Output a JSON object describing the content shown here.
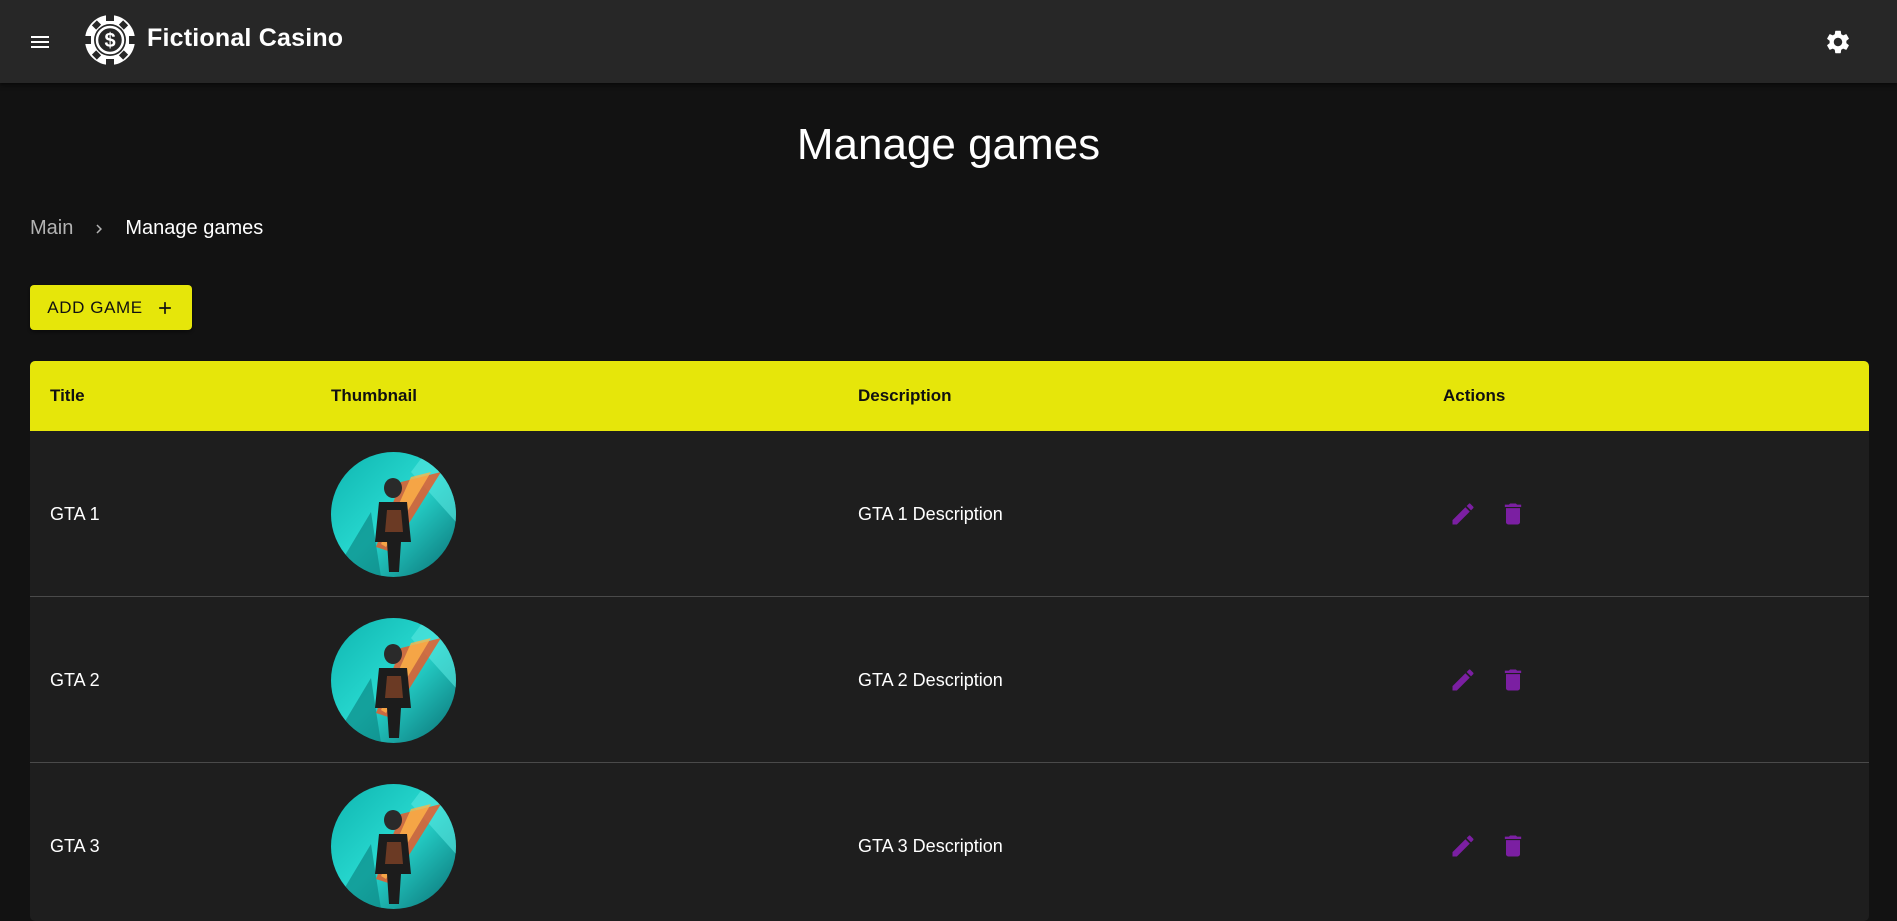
{
  "header": {
    "app_title": "Fictional Casino",
    "menu_icon": "menu-icon",
    "logo_icon": "casino-chip-dollar-icon",
    "settings_icon": "gear-icon"
  },
  "page": {
    "title": "Manage games"
  },
  "breadcrumb": {
    "items": [
      "Main",
      "Manage games"
    ]
  },
  "toolbar": {
    "add_label": "ADD GAME",
    "add_icon": "plus-icon"
  },
  "table": {
    "columns": [
      "Title",
      "Thumbnail",
      "Description",
      "Actions"
    ],
    "rows": [
      {
        "title": "GTA 1",
        "description": "GTA 1 Description"
      },
      {
        "title": "GTA 2",
        "description": "GTA 2 Description"
      },
      {
        "title": "GTA 3",
        "description": "GTA 3 Description"
      }
    ],
    "action_icons": [
      "pencil-edit-icon",
      "trash-delete-icon"
    ]
  },
  "colors": {
    "accent": "#e6e60a",
    "action_icon": "#7b1fa2",
    "appbar": "#272727",
    "background": "#121212"
  }
}
